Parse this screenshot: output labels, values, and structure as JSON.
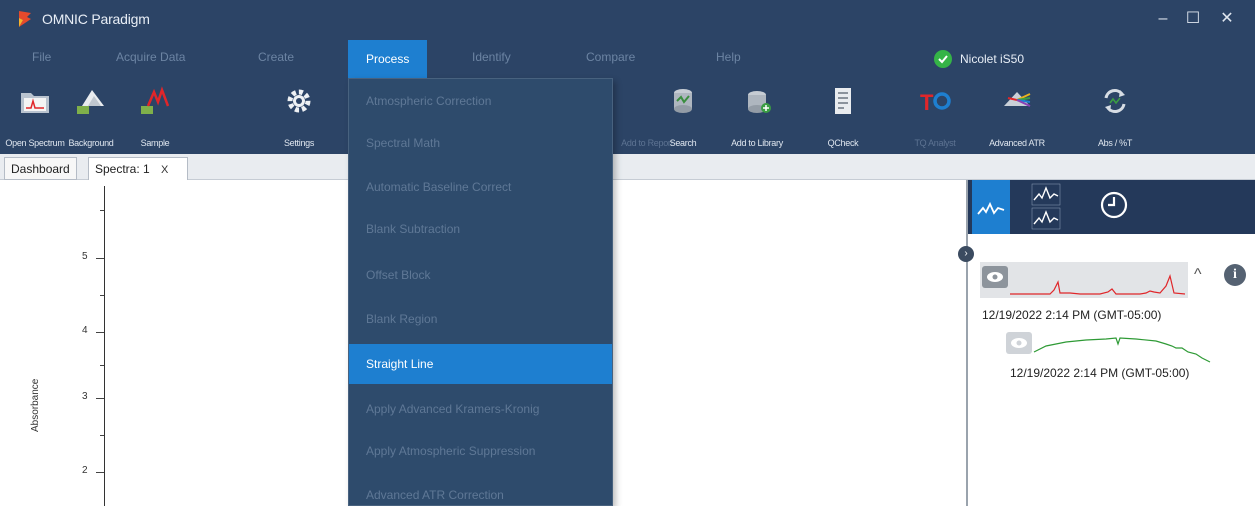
{
  "app": {
    "title": "OMNIC Paradigm"
  },
  "window_controls": {
    "minimize": "–",
    "maximize": "☐",
    "close": "✕"
  },
  "menu": {
    "items": [
      "File",
      "Acquire Data",
      "Create",
      "Process",
      "Identify",
      "Compare",
      "Help"
    ],
    "active": "Process"
  },
  "instrument": {
    "name": "Nicolet iS50",
    "status_color": "#35b447"
  },
  "toolbar": {
    "buttons": [
      {
        "label": "Open Spectrum",
        "icon": "folder-spectrum-icon"
      },
      {
        "label": "Background",
        "icon": "background-mountain-icon"
      },
      {
        "label": "Sample",
        "icon": "sample-spectrum-icon"
      },
      {
        "label": "Settings",
        "icon": "gear-icon"
      },
      {
        "label": "Add to Report",
        "icon": "report-icon"
      },
      {
        "label": "Search",
        "icon": "search-library-icon"
      },
      {
        "label": "Add to Library",
        "icon": "add-library-icon"
      },
      {
        "label": "QCheck",
        "icon": "qcheck-icon"
      },
      {
        "label": "TQ Analyst",
        "icon": "tq-icon"
      },
      {
        "label": "Advanced ATR",
        "icon": "prism-icon"
      },
      {
        "label": "Abs / %T",
        "icon": "convert-arrows-icon"
      }
    ]
  },
  "tabs": {
    "dashboard": "Dashboard",
    "spectra": "Spectra: 1",
    "close_glyph": "X"
  },
  "plot": {
    "ylabel": "Absorbance",
    "yticks": [
      "5",
      "4",
      "3",
      "2"
    ]
  },
  "process_menu": {
    "items": [
      "Atmospheric Correction",
      "Spectral Math",
      "Automatic Baseline Correct",
      "Blank Subtraction",
      "Offset Block",
      "Blank Region",
      "Straight Line",
      "Apply Advanced Kramers-Kronig",
      "Apply Atmospheric Suppression",
      "Advanced ATR Correction"
    ],
    "active_index": 6
  },
  "right_panel": {
    "spectra": [
      {
        "timestamp": "12/19/2022 2:14 PM (GMT-05:00)",
        "color": "#e0262a"
      },
      {
        "timestamp": "12/19/2022 2:14 PM (GMT-05:00)",
        "color": "#2e9a35"
      }
    ],
    "info_glyph": "i",
    "collapse_glyph": "^"
  },
  "colors": {
    "accent": "#1e7fd0",
    "chrome": "#2c4466"
  }
}
